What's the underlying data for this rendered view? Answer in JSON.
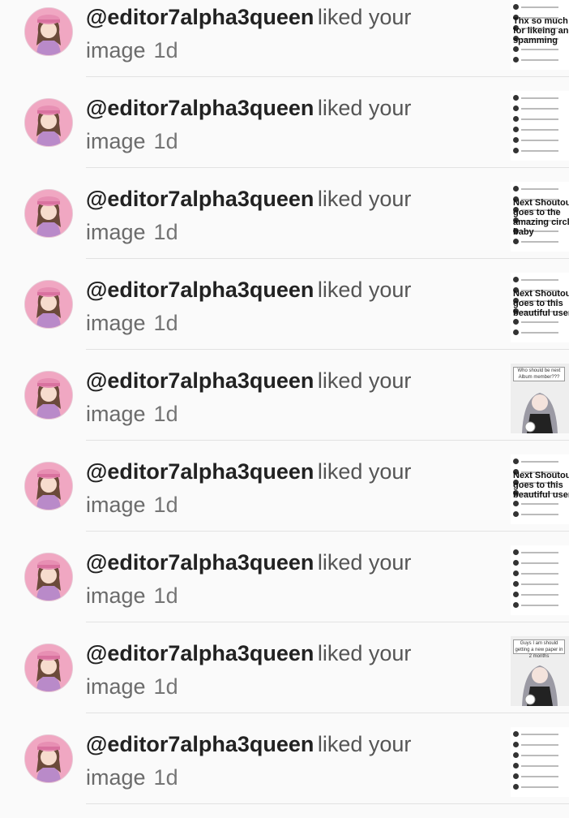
{
  "notifications": [
    {
      "username": "@editor7alpha3queen",
      "action": "liked your",
      "object": "image",
      "time": "1d",
      "thumb": {
        "type": "text",
        "caption": "Thx so much for likeing and spamming"
      }
    },
    {
      "username": "@editor7alpha3queen",
      "action": "liked your",
      "object": "image",
      "time": "1d",
      "thumb": {
        "type": "list",
        "caption": ""
      }
    },
    {
      "username": "@editor7alpha3queen",
      "action": "liked your",
      "object": "image",
      "time": "1d",
      "thumb": {
        "type": "text",
        "caption": "Next Shoutout goes to the amazing circle baby"
      }
    },
    {
      "username": "@editor7alpha3queen",
      "action": "liked your",
      "object": "image",
      "time": "1d",
      "thumb": {
        "type": "text",
        "caption": "Next Shoutout goes to this beautiful user"
      }
    },
    {
      "username": "@editor7alpha3queen",
      "action": "liked your",
      "object": "image",
      "time": "1d",
      "thumb": {
        "type": "art",
        "caption": "Who should be next Album member???"
      }
    },
    {
      "username": "@editor7alpha3queen",
      "action": "liked your",
      "object": "image",
      "time": "1d",
      "thumb": {
        "type": "text",
        "caption": "Next Shoutout goes to this beautiful user"
      }
    },
    {
      "username": "@editor7alpha3queen",
      "action": "liked your",
      "object": "image",
      "time": "1d",
      "thumb": {
        "type": "list",
        "caption": ""
      }
    },
    {
      "username": "@editor7alpha3queen",
      "action": "liked your",
      "object": "image",
      "time": "1d",
      "thumb": {
        "type": "art",
        "caption": "Guys I am should getting a new paper in 2 months"
      }
    },
    {
      "username": "@editor7alpha3queen",
      "action": "liked your",
      "object": "image",
      "time": "1d",
      "thumb": {
        "type": "list",
        "caption": ""
      }
    }
  ]
}
